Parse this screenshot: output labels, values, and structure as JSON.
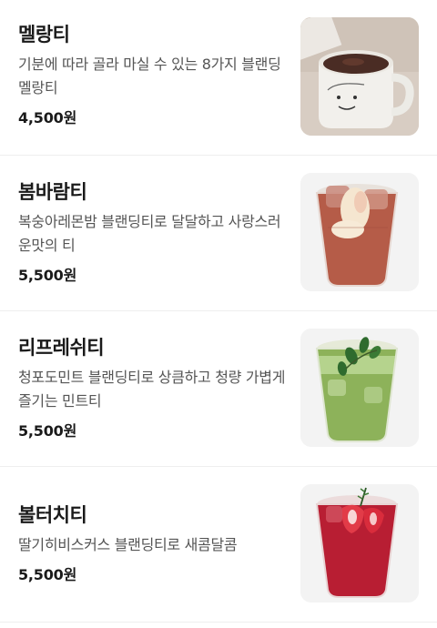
{
  "menu": {
    "items": [
      {
        "name": "멜랑티",
        "description": "기분에 따라 골라 마실 수 있는 8가지 블랜딩 멜랑티",
        "price": "4,500원",
        "image": "mug-tea-image"
      },
      {
        "name": "봄바람티",
        "description": "복숭아레몬밤 블랜딩티로 달달하고 사랑스러운맛의 티",
        "price": "5,500원",
        "image": "peach-iced-tea-image"
      },
      {
        "name": "리프레쉬티",
        "description": "청포도민트 블랜딩티로 상큼하고 청량 가볍게 즐기는 민트티",
        "price": "5,500원",
        "image": "green-grape-mint-tea-image"
      },
      {
        "name": "볼터치티",
        "description": "딸기히비스커스 블랜딩티로 새콤달콤",
        "price": "5,500원",
        "image": "strawberry-hibiscus-tea-image"
      }
    ]
  },
  "colors": {
    "text": "#1a1a1a",
    "description": "#555555",
    "divider": "#eeeeee",
    "thumb_background": "#f3f3f3"
  }
}
